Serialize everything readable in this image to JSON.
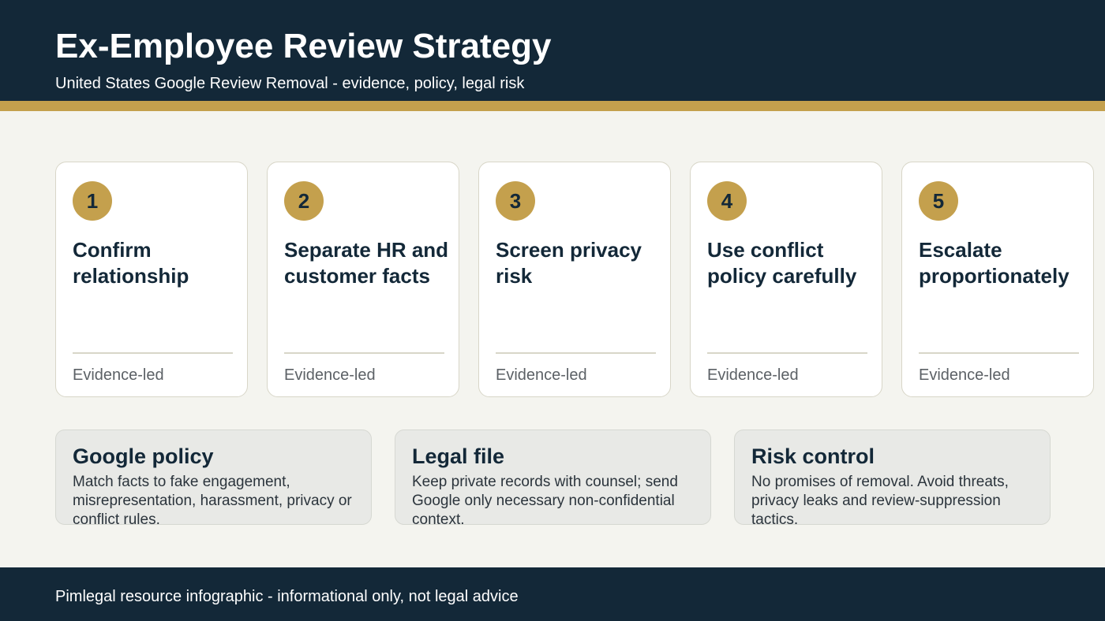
{
  "header": {
    "title": "Ex-Employee Review Strategy",
    "subtitle": "United States Google Review Removal - evidence, policy, legal risk"
  },
  "steps": [
    {
      "number": "1",
      "title": "Confirm relationship",
      "tag": "Evidence-led"
    },
    {
      "number": "2",
      "title": "Separate HR and customer facts",
      "tag": "Evidence-led"
    },
    {
      "number": "3",
      "title": "Screen privacy risk",
      "tag": "Evidence-led"
    },
    {
      "number": "4",
      "title": "Use conflict policy carefully",
      "tag": "Evidence-led"
    },
    {
      "number": "5",
      "title": "Escalate proportionately",
      "tag": "Evidence-led"
    }
  ],
  "info_cards": [
    {
      "title": "Google policy",
      "body": "Match facts to fake engagement, misrepresentation, harassment, privacy or conflict rules."
    },
    {
      "title": "Legal file",
      "body": "Keep private records with counsel; send Google only necessary non-confidential context."
    },
    {
      "title": "Risk control",
      "body": "No promises of removal. Avoid threats, privacy leaks and review-suppression tactics."
    }
  ],
  "footer": {
    "text": "Pimlegal resource infographic - informational only, not legal advice"
  },
  "colors": {
    "navy": "#132838",
    "gold": "#c4a04d",
    "background": "#f4f4ef",
    "card": "#ffffff",
    "info_card": "#e8e9e6"
  }
}
